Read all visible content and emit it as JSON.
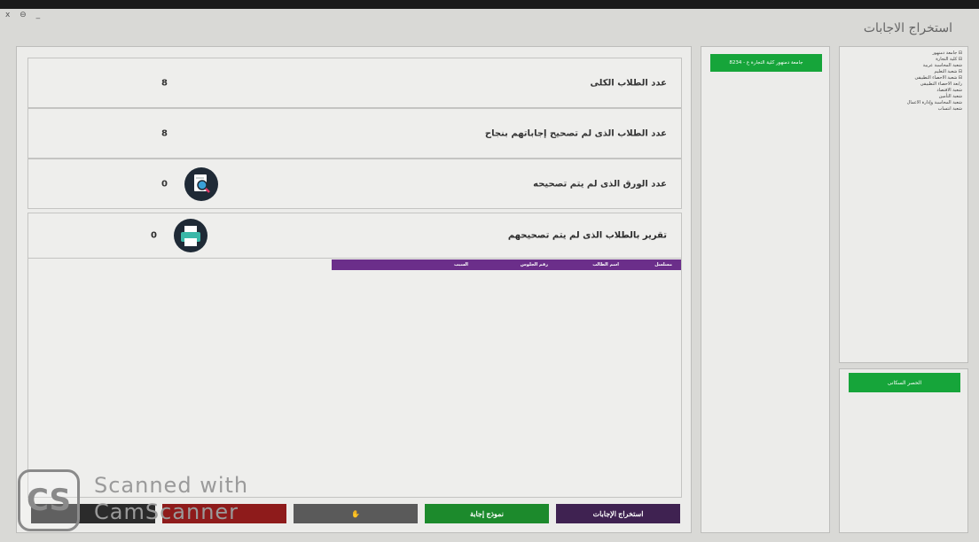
{
  "window": {
    "controls": "x  ⊖  _",
    "title": "استخراج الاجابات"
  },
  "stats": [
    {
      "label": "عدد الطلاب الكلى",
      "value": "8"
    },
    {
      "label": "عدد الطلاب الذى لم تصحيح إجاباتهم بنجاح",
      "value": "8"
    },
    {
      "label": "عدد الورق الذى لم يتم تصحيحه",
      "value": "0",
      "icon": "magnifier-document-icon"
    }
  ],
  "report": {
    "label": "تقرير بالطلاب الذى لم يتم تصحيحهم",
    "value": "0",
    "icon": "printer-icon",
    "table_headers": [
      "مسلسل",
      "اسم الطالب",
      "رقم الجلوس",
      "السبب"
    ]
  },
  "buttons": {
    "extract": "استخراج الإجابات",
    "model_answer": "نموذج إجابة",
    "gray": "",
    "red": "",
    "dark": ""
  },
  "middle": {
    "green_button": "جامعة دمنهور  كلية التجارة  ع - 8234"
  },
  "tree": {
    "items": [
      "⊟ جامعة دمنهور",
      "  ⊟ كلية التجارة",
      "    شعبة المحاسبة عربية",
      "    ⊟ شعبة التعليم",
      "      ⊟ شعبة الاحصاء التطبيقى",
      "        رابعة الاحصاء التطبيقى",
      "      شعبة الاقتصاد",
      "      شعبة التأمين",
      "      شعبة المحاسبة وإدارة الاعمال",
      "      شعبة انتساب"
    ]
  },
  "bottom": {
    "green_button": "الحصر السكانى"
  },
  "watermark": {
    "logo": "CS",
    "line1": "Scanned with",
    "line2": "CamScanner"
  },
  "colors": {
    "purple_header": "#6b2e8a",
    "green": "#16a53a",
    "dark_purple": "#3f2251",
    "red": "#8e1b1b"
  }
}
